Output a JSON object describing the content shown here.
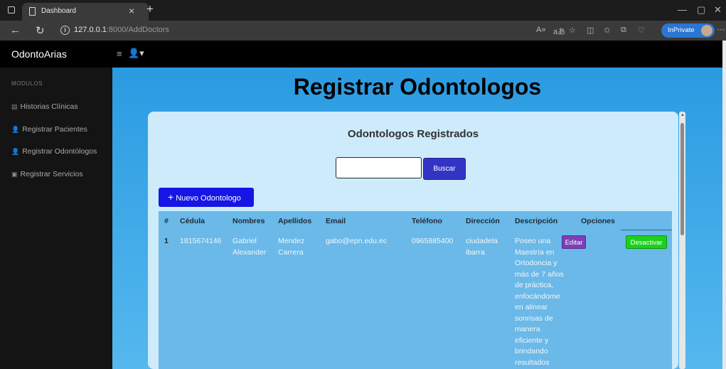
{
  "browser": {
    "tab_title": "Dashboard",
    "url_host": "127.0.0.1",
    "url_rest": ":8000/AddDoctors",
    "inprivate_label": "InPrivate"
  },
  "app": {
    "brand": "OdontoArias",
    "sidebar_heading": "MODULOS",
    "sidebar_items": [
      {
        "label": "Historias Clínicas",
        "icon": "table-icon"
      },
      {
        "label": "Registrar Pacientes",
        "icon": "user-add-icon"
      },
      {
        "label": "Registrar Odontólogos",
        "icon": "user-add-icon"
      },
      {
        "label": "Registrar Servicios",
        "icon": "list-icon"
      }
    ]
  },
  "main": {
    "page_title": "Registrar Odontologos",
    "card_title": "Odontologos Registrados",
    "search_value": "",
    "search_button": "Buscar",
    "new_button": "Nuevo Odontologo",
    "table": {
      "headers": [
        "#",
        "Cédula",
        "Nombres",
        "Apellidos",
        "Email",
        "Teléfono",
        "Dirección",
        "Descripción",
        "Opciones"
      ],
      "rows": [
        {
          "num": "1",
          "cedula": "1815674146",
          "nombres": "Gabriel Alexander",
          "apellidos": "Mendez Carrera",
          "email": "gabo@epn.edu.ec",
          "telefono": "0965885400",
          "direccion": "ciudadela ibarra",
          "descripcion": "Poseo una Maestría en Ortodoncia y más de 7 años de práctica, enfocándome en alinear sonrisas de manera eficiente y brindando resultados",
          "edit_label": "Editar",
          "deactivate_label": "Desactivar"
        }
      ]
    }
  }
}
